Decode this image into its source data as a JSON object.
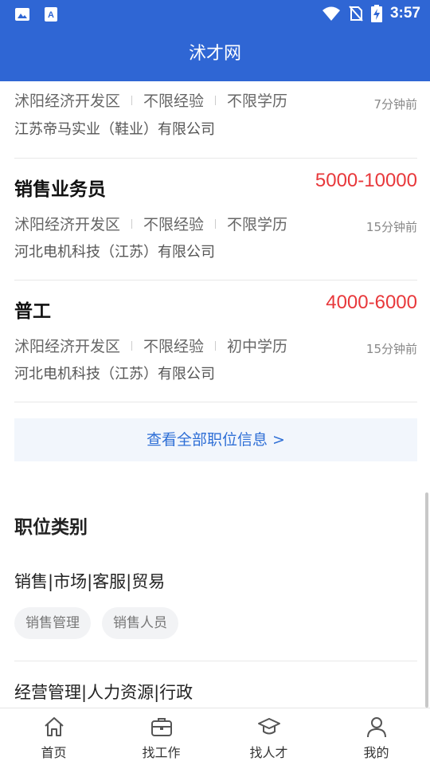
{
  "status": {
    "time": "3:57"
  },
  "header": {
    "title": "沭才网"
  },
  "jobs": [
    {
      "title": "",
      "salary": "",
      "location": "沭阳经济开发区",
      "experience": "不限经验",
      "education": "不限学历",
      "time": "7分钟前",
      "company": "江苏帝马实业（鞋业）有限公司"
    },
    {
      "title": "销售业务员",
      "salary": "5000-10000",
      "location": "沭阳经济开发区",
      "experience": "不限经验",
      "education": "不限学历",
      "time": "15分钟前",
      "company": "河北电机科技（江苏）有限公司"
    },
    {
      "title": "普工",
      "salary": "4000-6000",
      "location": "沭阳经济开发区",
      "experience": "不限经验",
      "education": "初中学历",
      "time": "15分钟前",
      "company": "河北电机科技（江苏）有限公司"
    }
  ],
  "view_all": "查看全部职位信息 >",
  "categories": {
    "title": "职位类别",
    "groups": [
      {
        "name": "销售|市场|客服|贸易",
        "tags": [
          "销售管理",
          "销售人员"
        ]
      },
      {
        "name": "经营管理|人力资源|行政",
        "tags": []
      }
    ]
  },
  "tabbar": [
    {
      "label": "首页",
      "icon": "home-icon"
    },
    {
      "label": "找工作",
      "icon": "briefcase-icon"
    },
    {
      "label": "找人才",
      "icon": "graduation-cap-icon"
    },
    {
      "label": "我的",
      "icon": "user-icon"
    }
  ]
}
